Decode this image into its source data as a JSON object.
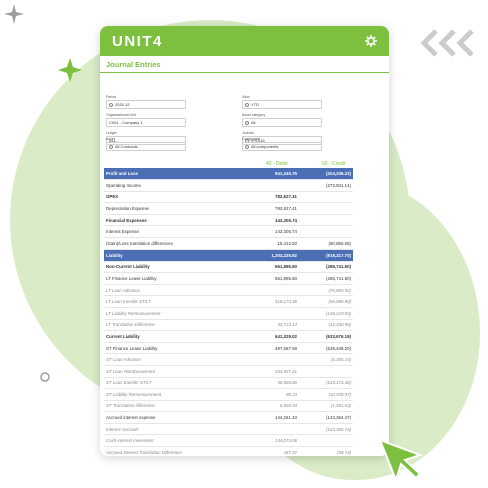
{
  "brand": {
    "logo": "UNIT4",
    "accent": "#7dbf3e",
    "header_blue": "#4a6fb5"
  },
  "page": {
    "title": "Journal Entries"
  },
  "filters": [
    {
      "label": "Period",
      "value": "2020 12",
      "radio": true
    },
    {
      "label": "View",
      "value": "YTD",
      "radio": true
    },
    {
      "label": "Organizational Unit",
      "value": "C001 - Company 1",
      "radio": false
    },
    {
      "label": "Asset category",
      "value": "All",
      "radio": true
    },
    {
      "label": "Ledger",
      "value": "ALL -",
      "radio": false
    },
    {
      "label": "Journal",
      "value": "IFRS16",
      "radio": true
    },
    {
      "label": "Asset",
      "value": "All Contracts -",
      "radio": true
    },
    {
      "label": "Component",
      "value": "All components",
      "radio": true
    }
  ],
  "columns": {
    "debit": "40 - Debit",
    "credit": "50 - Credit"
  },
  "rows": [
    {
      "label": "Profit and Loss",
      "debit": "941,345.75",
      "credit": "(324,336.22)",
      "style": "head"
    },
    {
      "label": "Operating Income",
      "debit": "",
      "credit": "(273,501.14)",
      "style": ""
    },
    {
      "label": "OPEX",
      "debit": "782,627.41",
      "credit": "",
      "style": "bold"
    },
    {
      "label": "Depreciation Expense",
      "debit": "782,627.41",
      "credit": "",
      "style": ""
    },
    {
      "label": "Financial Expenses",
      "debit": "143,305.74",
      "credit": "",
      "style": "bold"
    },
    {
      "label": "Interest Expense",
      "debit": "143,305.74",
      "credit": "",
      "style": ""
    },
    {
      "label": "(Gain)/Loss translation differences",
      "debit": "15,412.50",
      "credit": "(50,855.08)",
      "style": ""
    },
    {
      "label": "Liability",
      "debit": "1,203,225.92",
      "credit": "(919,317.70)",
      "style": "head"
    },
    {
      "label": "Non-Current Liability",
      "debit": "561,896.60",
      "credit": "(286,741.50)",
      "style": "bold"
    },
    {
      "label": "LT Finance Lease Liability",
      "debit": "561,895.60",
      "credit": "(286,741.50)",
      "style": ""
    },
    {
      "label": "LT Loan Advance",
      "debit": "",
      "credit": "(70,893.92)",
      "style": "italic"
    },
    {
      "label": "LT Loan transfer ST/LT",
      "debit": "518,173.46",
      "credit": "(56,686.80)",
      "style": "italic"
    },
    {
      "label": "LT Liability Remeasurement",
      "debit": "",
      "credit": "(146,219.83)",
      "style": "italic"
    },
    {
      "label": "LT Translation Difference",
      "debit": "43,723.14",
      "credit": "(13,430.99)",
      "style": "italic"
    },
    {
      "label": "Current Liability",
      "debit": "641,329.02",
      "credit": "(633,676.19)",
      "style": "bold"
    },
    {
      "label": "ST Finance Lease Liability",
      "debit": "497,067.59",
      "credit": "(539,439.20)",
      "style": ""
    },
    {
      "label": "ST Loan Advance",
      "debit": "",
      "credit": "(6,355.15)",
      "style": "italic"
    },
    {
      "label": "ST Loan Reimbursement",
      "debit": "433,927.21",
      "credit": "",
      "style": "italic"
    },
    {
      "label": "ST Loan transfer ST/LT",
      "debit": "56,686.80",
      "credit": "(518,173.46)",
      "style": "italic"
    },
    {
      "label": "ST Liability Remeasurement",
      "debit": "90.23",
      "credit": "(10,978.97)",
      "style": "italic"
    },
    {
      "label": "ST Translation difference",
      "debit": "6,803.34",
      "credit": "(1,931.63)",
      "style": "italic"
    },
    {
      "label": "Accrued interest expense",
      "debit": "144,261.43",
      "credit": "(143,364.47)",
      "style": ""
    },
    {
      "label": "Interest Accruals",
      "debit": "",
      "credit": "(143,305.74)",
      "style": "italic"
    },
    {
      "label": "Cash interest movement",
      "debit": "144,074.06",
      "credit": "",
      "style": "italic"
    },
    {
      "label": "Accrued Interest Translation Difference",
      "debit": "187.37",
      "credit": "(58.74)",
      "style": "italic"
    },
    {
      "label": "Deferred Income",
      "debit": "",
      "credit": "49,727.40",
      "style": ""
    },
    {
      "label": "Deferred Income Net Variation",
      "debit": "",
      "credit": "49,727.40",
      "style": "italic"
    }
  ]
}
